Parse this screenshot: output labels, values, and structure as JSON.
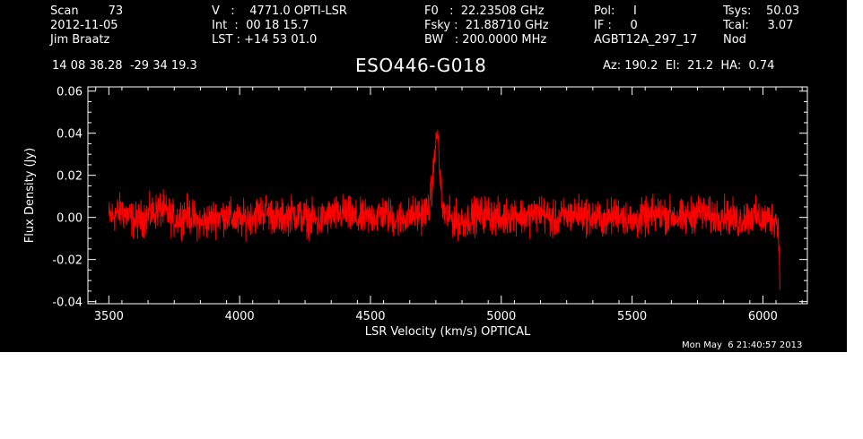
{
  "header": {
    "col1": [
      "Scan        73",
      "2012-11-05",
      "Jim Braatz"
    ],
    "col2": [
      "V   :    4771.0 OPTI-LSR",
      "Int  :  00 18 15.7",
      "LST : +14 53 01.0"
    ],
    "col3": [
      "F0   :  22.23508 GHz",
      "Fsky :  21.88710 GHz",
      "BW   : 200.0000 MHz"
    ],
    "col4": [
      "Pol:     I",
      "IF :     0",
      "AGBT12A_297_17"
    ],
    "col5": [
      "Tsys:    50.03",
      "Tcal:     3.07",
      "Nod"
    ],
    "coords": "14 08 38.28  -29 34 19.3",
    "source": "ESO446-G018",
    "azelha": "Az: 190.2  El:  21.2  HA:  0.74"
  },
  "footer_timestamp": "Mon May  6 21:40:57 2013",
  "colors": {
    "background": "#000000",
    "axes": "#ffffff",
    "spectrum": "#ff0000"
  },
  "chart_data": {
    "type": "line",
    "title": "ESO446-G018",
    "xlabel": "LSR Velocity (km/s) OPTICAL",
    "ylabel": "Flux Density (Jy)",
    "xlim": [
      3420,
      6170
    ],
    "ylim": [
      -0.041,
      0.062
    ],
    "x_ticks": [
      "3500",
      "4000",
      "4500",
      "5000",
      "5500",
      "6000"
    ],
    "y_ticks": [
      "0.06",
      "0.04",
      "0.02",
      "0.00",
      "-0.02",
      "-0.04"
    ],
    "grid": false,
    "series": [
      {
        "color": "#ff0000",
        "x": [
          3500,
          3550,
          3600,
          3650,
          3700,
          3750,
          3800,
          3850,
          3900,
          3950,
          4000,
          4050,
          4100,
          4150,
          4200,
          4250,
          4300,
          4350,
          4400,
          4450,
          4500,
          4550,
          4600,
          4650,
          4700,
          4720,
          4735,
          4745,
          4752,
          4757,
          4760,
          4765,
          4775,
          4790,
          4800,
          4850,
          4900,
          4950,
          5000,
          5050,
          5100,
          5150,
          5200,
          5250,
          5300,
          5350,
          5400,
          5450,
          5500,
          5550,
          5600,
          5650,
          5700,
          5750,
          5800,
          5850,
          5900,
          5950,
          6000,
          6050,
          6060,
          6065
        ],
        "y": [
          0.0,
          0.003,
          -0.002,
          0.001,
          0.004,
          -0.001,
          0.002,
          -0.003,
          0.0,
          0.001,
          -0.002,
          0.001,
          0.003,
          -0.001,
          0.002,
          0.0,
          -0.002,
          0.001,
          0.002,
          -0.001,
          0.0,
          0.002,
          -0.001,
          0.001,
          0.002,
          0.004,
          0.012,
          0.03,
          0.038,
          0.04,
          0.035,
          0.02,
          0.004,
          0.001,
          0.0,
          -0.002,
          0.001,
          0.002,
          -0.001,
          0.002,
          0.0,
          0.003,
          -0.002,
          0.001,
          0.002,
          0.0,
          -0.001,
          0.002,
          -0.002,
          0.0,
          0.002,
          0.001,
          -0.001,
          0.003,
          0.0,
          0.002,
          -0.002,
          0.001,
          -0.001,
          0.0,
          -0.008,
          -0.024
        ]
      }
    ]
  }
}
